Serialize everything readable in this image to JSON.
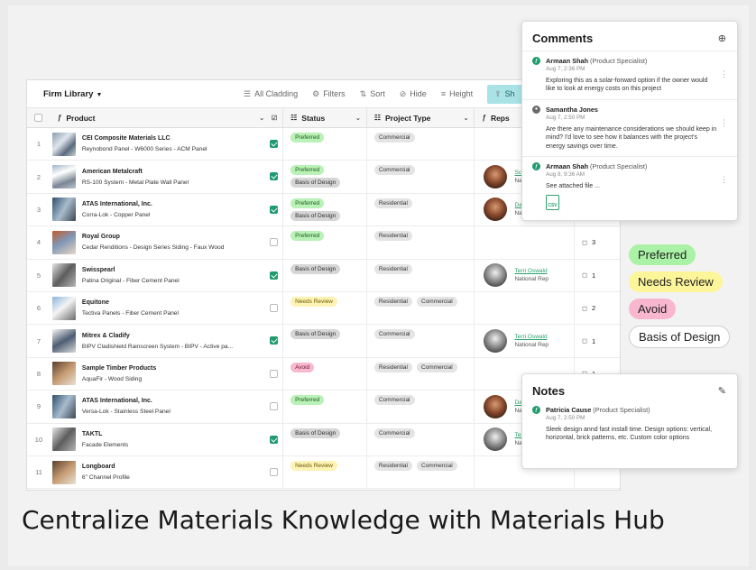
{
  "toolbar": {
    "library": "Firm Library",
    "items": [
      {
        "icon": "lines-icon",
        "label": "All Cladding"
      },
      {
        "icon": "filter-icon",
        "label": "Filters"
      },
      {
        "icon": "sort-icon",
        "label": "Sort"
      },
      {
        "icon": "eye-off-icon",
        "label": "Hide"
      },
      {
        "icon": "height-icon",
        "label": "Height"
      }
    ],
    "share": "Sh"
  },
  "columns": {
    "product": "Product",
    "status": "Status",
    "project_type": "Project Type",
    "reps": "Reps"
  },
  "rows": [
    {
      "num": "1",
      "name": "CEI Composite Materials LLC",
      "sub": "Reynobond Panel - W6000 Series - ACM Panel",
      "checked": true,
      "status": [
        "Preferred"
      ],
      "types": [
        "Commercial"
      ],
      "rep": null,
      "notes": ""
    },
    {
      "num": "2",
      "name": "American Metalcraft",
      "sub": "RS-100 System - Metal Plate Wall Panel",
      "checked": true,
      "status": [
        "Preferred",
        "Basis of Design"
      ],
      "types": [
        "Commercial"
      ],
      "rep": {
        "name": "Scott Sam",
        "role": "National Re"
      },
      "notes": ""
    },
    {
      "num": "3",
      "name": "ATAS International, Inc.",
      "sub": "Corra-Lok - Copper Panel",
      "checked": true,
      "status": [
        "Preferred",
        "Basis of Design"
      ],
      "types": [
        "Residential"
      ],
      "rep": {
        "name": "David Wed",
        "role": "National Re"
      },
      "notes": ""
    },
    {
      "num": "4",
      "name": "Royal Group",
      "sub": "Cedar Renditions - Design Series Siding - Faux Wood",
      "checked": false,
      "status": [
        "Preferred"
      ],
      "types": [
        "Residential"
      ],
      "rep": null,
      "notes": "3"
    },
    {
      "num": "5",
      "name": "Swisspearl",
      "sub": "Patina Original - Fiber Cement Panel",
      "checked": true,
      "status": [
        "Basis of Design"
      ],
      "types": [
        "Residential"
      ],
      "rep": {
        "name": "Terri Oswald",
        "role": "National Rep"
      },
      "notes": "1"
    },
    {
      "num": "6",
      "name": "Equitone",
      "sub": "Tectiva Panels - Fiber Cement Panel",
      "checked": false,
      "status": [
        "Needs Review"
      ],
      "types": [
        "Residential",
        "Commercial"
      ],
      "rep": null,
      "notes": "2"
    },
    {
      "num": "7",
      "name": "Mitrex & Cladify",
      "sub": "BIPV Cladishield Rainscreen System - BIPV - Active pa...",
      "checked": true,
      "status": [
        "Basis of Design"
      ],
      "types": [
        "Commercial"
      ],
      "rep": {
        "name": "Terri Oswald",
        "role": "National Rep"
      },
      "notes": "1"
    },
    {
      "num": "8",
      "name": "Sample Timber Products",
      "sub": "AquaFir - Wood Siding",
      "checked": false,
      "status": [
        "Avoid"
      ],
      "types": [
        "Residential",
        "Commercial"
      ],
      "rep": null,
      "notes": "1"
    },
    {
      "num": "9",
      "name": "ATAS International, Inc.",
      "sub": "Versa-Lok - Stainless Steel Panel",
      "checked": false,
      "status": [
        "Preferred"
      ],
      "types": [
        "Commercial"
      ],
      "rep": {
        "name": "David Wed",
        "role": "National Re"
      },
      "notes": ""
    },
    {
      "num": "10",
      "name": "TAKTL",
      "sub": "Facade Elements",
      "checked": true,
      "status": [
        "Basis of Design"
      ],
      "types": [
        "Commercial"
      ],
      "rep": {
        "name": "Terri Osw",
        "role": "National Re"
      },
      "notes": ""
    },
    {
      "num": "11",
      "name": "Longboard",
      "sub": "6\" Channel Profile",
      "checked": false,
      "status": [
        "Needs Review"
      ],
      "types": [
        "Residential",
        "Commercial"
      ],
      "rep": null,
      "notes": ""
    }
  ],
  "comments": {
    "title": "Comments",
    "items": [
      {
        "author": "Armaan Shah",
        "role": "(Product Specialist)",
        "time": "Aug 7, 2:36 PM",
        "text": "Exploring this as a solar-forward option if the owner would like to look at energy costs on this project",
        "avatar": "green"
      },
      {
        "author": "Samantha Jones",
        "role": "",
        "time": "Aug 7, 2:50 PM",
        "text": "Are there any maintenance considerations we should keep in mind? I'd love to see how it balances with the project's energy savings over time.",
        "avatar": "gray"
      },
      {
        "author": "Armaan Shah",
        "role": "(Product Specialist)",
        "time": "Aug 8, 9:36 AM",
        "text": "See attached file ...",
        "avatar": "green",
        "attachment": "CSV"
      }
    ]
  },
  "legend": [
    "Preferred",
    "Needs Review",
    "Avoid",
    "Basis of Design"
  ],
  "notes": {
    "title": "Notes",
    "author": "Patricia Cause",
    "role": "(Product Specialist)",
    "time": "Aug 7, 2:50 PM",
    "text": "Sleek design annd fast install time. Design options: vertical, horizontal, brick patterns, etc. Custom color options"
  },
  "caption": "Centralize Materials Knowledge with Materials Hub",
  "colors": {
    "accent": "#1f9b6e",
    "preferred": "#b9f1b6",
    "needs_review": "#fdf3b4",
    "avoid": "#f8b9cf",
    "basis_of_design": "#d6d6d6"
  }
}
